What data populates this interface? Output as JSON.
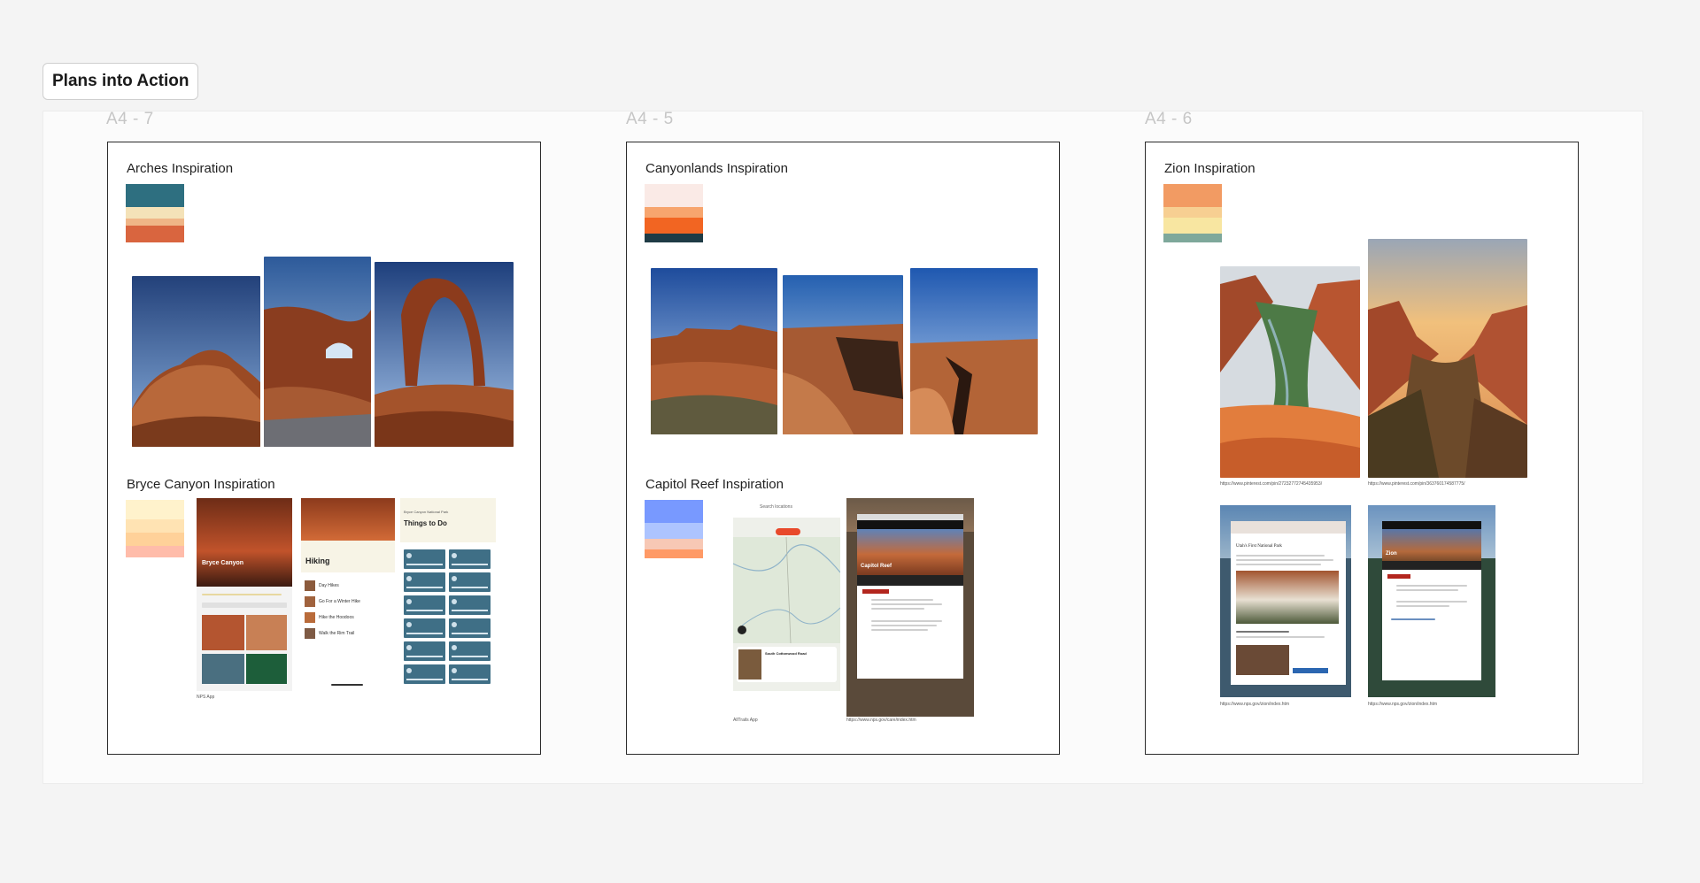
{
  "section": {
    "title": "Plans into Action"
  },
  "frames": [
    {
      "label": "A4 - 7",
      "top_heading": "Arches Inspiration",
      "bottom_heading": "Bryce Canyon Inspiration",
      "top_palette": [
        "#2e6f80",
        "#f4e2b8",
        "#efb587",
        "#d9653f"
      ],
      "bottom_palette": [
        "#fff2cc",
        "#ffe3b3",
        "#ffd199",
        "#ffbcaa"
      ],
      "photo_subjects": [
        "red-rock-dome",
        "rock-arch-window",
        "delicate-arch"
      ],
      "app_caption": "NPS App",
      "app_screens": {
        "park_name": "Bryce Canyon",
        "hiking_title": "Hiking",
        "hikes": [
          "Day Hikes",
          "Go For a Winter Hike",
          "Hike the Hoodoos",
          "Walk the Rim Trail"
        ],
        "things_title": "Things to Do",
        "things_subtitle": "Bryce Canyon National Park"
      }
    },
    {
      "label": "A4 - 5",
      "top_heading": "Canyonlands Inspiration",
      "bottom_heading": "Capitol Reef Inspiration",
      "top_palette": [
        "#faeae6",
        "#f7a56e",
        "#f26522",
        "#1f3b45"
      ],
      "bottom_palette": [
        "#7899ff",
        "#adc4ff",
        "#f7c8b5",
        "#ff9a66"
      ],
      "photo_subjects": [
        "canyon-rim",
        "deep-gorge",
        "cracked-slickrock"
      ],
      "app_caption": "AllTrails App",
      "url_caption": "https://www.nps.gov/care/index.htm",
      "app_screens": {
        "search_placeholder": "Search locations",
        "trail_name": "South Cottonwood Road",
        "site_title": "Capitol Reef"
      }
    },
    {
      "label": "A4 - 6",
      "top_heading": "Zion Inspiration",
      "top_palette": [
        "#f29b63",
        "#f7cf92",
        "#f8e6a1",
        "#7ea89b"
      ],
      "photo_subjects": [
        "zion-canyon-overlook",
        "zion-canyon-sunset"
      ],
      "url_captions": [
        "https://www.pinterest.com/pin/27232772745435953/",
        "https://www.pinterest.com/pin/363760174587775/"
      ],
      "site_captions": [
        "https://www.nps.gov/zion/index.htm",
        "https://www.nps.gov/zion/index.htm"
      ],
      "site_screens": {
        "headline": "Utah's First National Park",
        "site_title": "Zion"
      }
    }
  ]
}
